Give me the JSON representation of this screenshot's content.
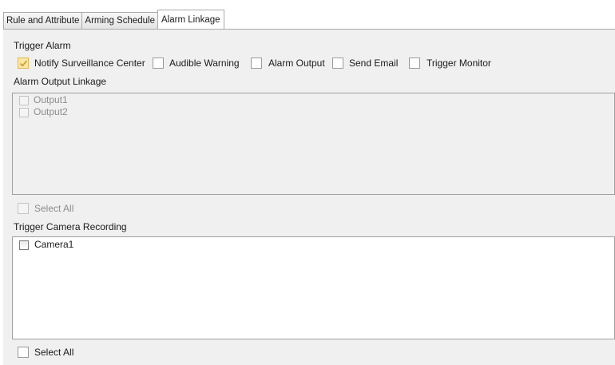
{
  "tabs": [
    {
      "label": "Rule and Attribute",
      "active": false
    },
    {
      "label": "Arming Schedule",
      "active": false
    },
    {
      "label": "Alarm Linkage",
      "active": true
    }
  ],
  "trigger_alarm": {
    "title": "Trigger Alarm",
    "options": [
      {
        "label": "Notify Surveillance Center",
        "checked": true
      },
      {
        "label": "Audible Warning",
        "checked": false
      },
      {
        "label": "Alarm Output",
        "checked": false
      },
      {
        "label": "Send Email",
        "checked": false
      },
      {
        "label": "Trigger Monitor",
        "checked": false
      }
    ]
  },
  "alarm_output_linkage": {
    "title": "Alarm Output Linkage",
    "items": [
      {
        "label": "Output1",
        "checked": false,
        "enabled": false
      },
      {
        "label": "Output2",
        "checked": false,
        "enabled": false
      }
    ],
    "select_all": {
      "label": "Select All",
      "checked": false,
      "enabled": false
    }
  },
  "trigger_camera_recording": {
    "title": "Trigger Camera Recording",
    "items": [
      {
        "label": "Camera1",
        "checked": false,
        "enabled": true
      }
    ],
    "select_all": {
      "label": "Select All",
      "checked": false,
      "enabled": true
    }
  },
  "colors": {
    "panel_bg": "#f0f0f0",
    "checked_fill": "#fce7a6",
    "checked_border": "#e2b54f",
    "checkmark": "#c79a2c",
    "disabled_text": "#8c8c8c"
  }
}
